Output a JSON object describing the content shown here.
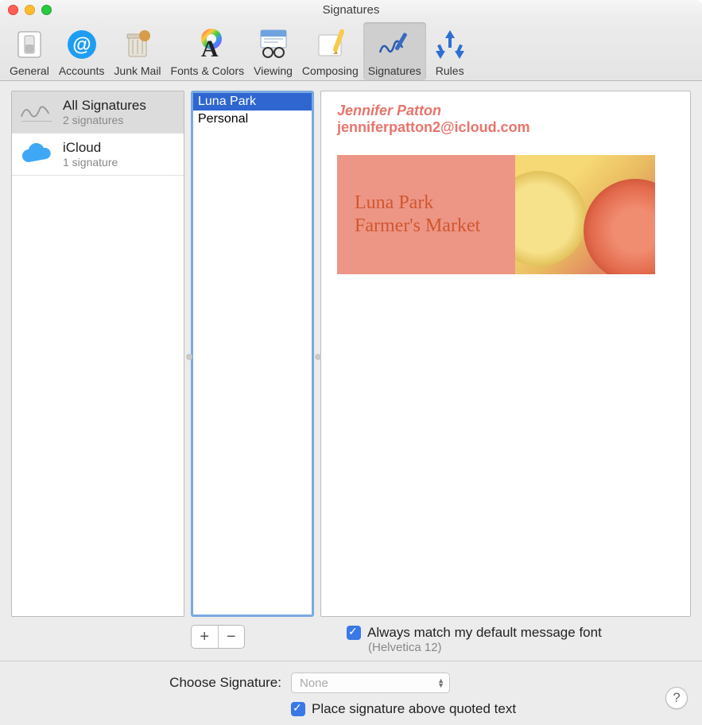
{
  "window": {
    "title": "Signatures"
  },
  "toolbar": {
    "items": [
      {
        "label": "General"
      },
      {
        "label": "Accounts"
      },
      {
        "label": "Junk Mail"
      },
      {
        "label": "Fonts & Colors"
      },
      {
        "label": "Viewing"
      },
      {
        "label": "Composing"
      },
      {
        "label": "Signatures"
      },
      {
        "label": "Rules"
      }
    ]
  },
  "accounts": {
    "items": [
      {
        "title": "All Signatures",
        "subtitle": "2 signatures"
      },
      {
        "title": "iCloud",
        "subtitle": "1 signature"
      }
    ]
  },
  "signatures": {
    "items": [
      {
        "name": "Luna Park"
      },
      {
        "name": "Personal"
      }
    ]
  },
  "preview": {
    "name": "Jennifer Patton",
    "email": "jenniferpatton2@icloud.com",
    "banner_line1": "Luna Park",
    "banner_line2": "Farmer's Market"
  },
  "options": {
    "match_font_label": "Always match my default message font",
    "match_font_sub": "(Helvetica 12)",
    "choose_label": "Choose Signature:",
    "choose_value": "None",
    "place_above_label": "Place signature above quoted text"
  },
  "buttons": {
    "add": "+",
    "remove": "−"
  }
}
